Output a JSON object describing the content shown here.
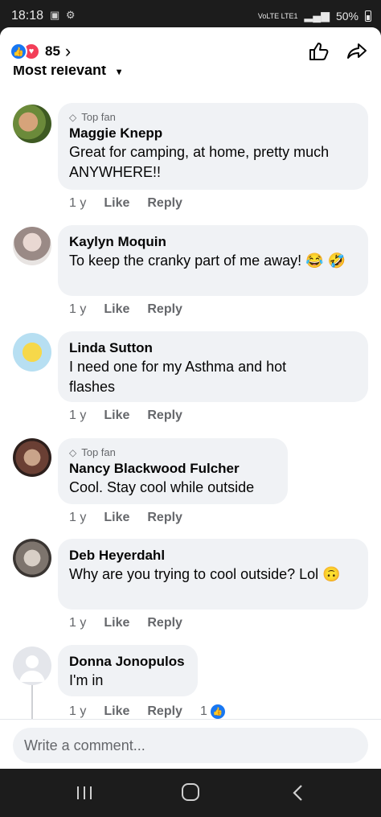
{
  "status_bar": {
    "time": "18:18",
    "left_icons": "▣ ⚙",
    "network": "VoLTE LTE1",
    "battery": "50%"
  },
  "header": {
    "reaction_count": "85",
    "sort_label": "Most relevant"
  },
  "comments": [
    {
      "badge": "Top fan",
      "author": "Maggie Knepp",
      "text": "Great for camping, at home, pretty much ANYWHERE!!",
      "time": "1 y",
      "like": "Like",
      "reply": "Reply"
    },
    {
      "badge": "",
      "author": "Kaylyn Moquin",
      "text": "To keep the cranky part of me away! 😂 🤣",
      "time": "1 y",
      "like": "Like",
      "reply": "Reply"
    },
    {
      "badge": "",
      "author": "Linda Sutton",
      "text": "I need one for my Asthma and hot flashes",
      "time": "1 y",
      "like": "Like",
      "reply": "Reply"
    },
    {
      "badge": "Top fan",
      "author": "Nancy Blackwood Fulcher",
      "text": "Cool. Stay cool while outside",
      "time": "1 y",
      "like": "Like",
      "reply": "Reply"
    },
    {
      "badge": "",
      "author": "Deb Heyerdahl",
      "text": "Why are you trying to cool outside? Lol 🙃",
      "time": "1 y",
      "like": "Like",
      "reply": "Reply"
    },
    {
      "badge": "",
      "author": "Donna Jonopulos",
      "text": "I'm in",
      "time": "1 y",
      "like": "Like",
      "reply": "Reply",
      "like_count": "1"
    }
  ],
  "composer": {
    "placeholder": "Write a comment..."
  },
  "colors": {
    "accent": "#1877f2",
    "love": "#f33e58",
    "bubble": "#f0f2f5",
    "secondary_text": "#65676b"
  }
}
